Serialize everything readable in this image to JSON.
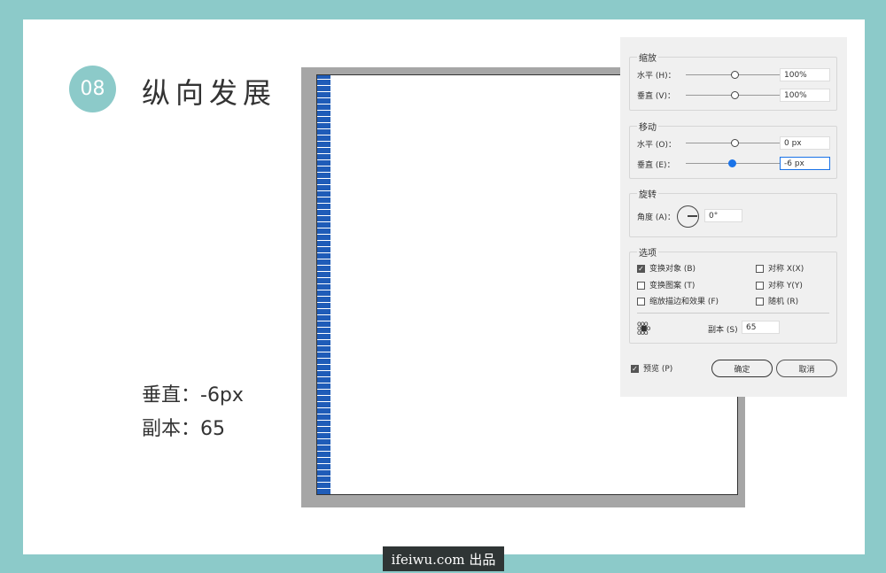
{
  "step": {
    "number": "08",
    "title": "纵向发展"
  },
  "notes": [
    "垂直：-6px",
    "副本：65"
  ],
  "dialog": {
    "scale": {
      "label": "缩放",
      "h_label": "水平 (H)：",
      "h_value": "100%",
      "v_label": "垂直 (V)：",
      "v_value": "100%"
    },
    "move": {
      "label": "移动",
      "h_label": "水平 (O)：",
      "h_value": "0 px",
      "v_label": "垂直 (E)：",
      "v_value": "-6 px"
    },
    "rotate": {
      "label": "旋转",
      "angle_label": "角度 (A)：",
      "angle_value": "0°"
    },
    "options": {
      "label": "选项",
      "items": [
        {
          "label": "变换对象 (B)",
          "checked": true
        },
        {
          "label": "对称 X(X)",
          "checked": false
        },
        {
          "label": "变换图案 (T)",
          "checked": false
        },
        {
          "label": "对称 Y(Y)",
          "checked": false
        },
        {
          "label": "缩放描边和效果 (F)",
          "checked": false
        },
        {
          "label": "随机 (R)",
          "checked": false
        }
      ],
      "copies_label": "副本 (S)",
      "copies_value": "65"
    },
    "preview": {
      "label": "预览 (P)",
      "checked": true
    },
    "ok": "确定",
    "cancel": "取消"
  },
  "footer": "ifeiwu.com 出品"
}
